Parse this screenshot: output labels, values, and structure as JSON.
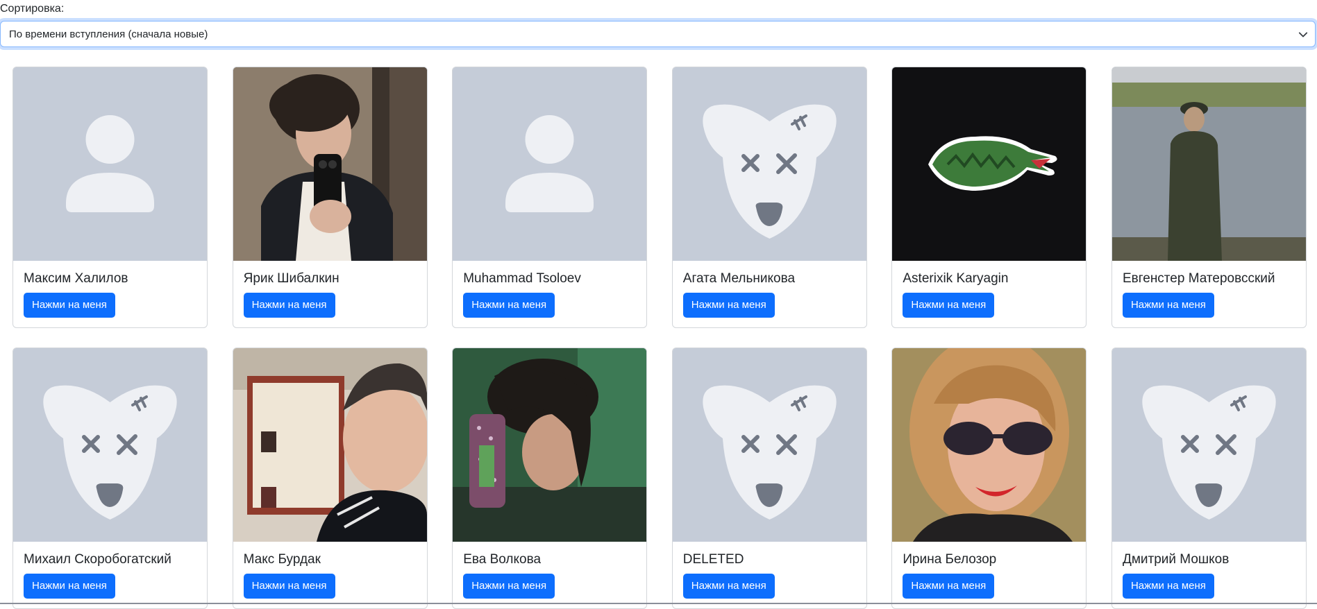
{
  "sort": {
    "label": "Сортировка:",
    "selected": "По времени вступления (сначала новые)"
  },
  "button_color": "#0d6efd",
  "members": [
    {
      "name": "Максим Халилов",
      "button": "Нажми на меня",
      "avatar": "default-person-avatar"
    },
    {
      "name": "Ярик Шибалкин",
      "button": "Нажми на меня",
      "avatar": "photo-mirror-selfie"
    },
    {
      "name": "Muhammad Tsoloev",
      "button": "Нажми на меня",
      "avatar": "default-person-avatar"
    },
    {
      "name": "Агата Мельникова",
      "button": "Нажми на меня",
      "avatar": "deleted-dog-avatar"
    },
    {
      "name": "Asterixik Karyagin",
      "button": "Нажми на меня",
      "avatar": "photo-crocodile-logo"
    },
    {
      "name": "Евгенстер Матеровсский",
      "button": "Нажми на меня",
      "avatar": "photo-man-by-lake"
    },
    {
      "name": "Михаил Скоробогатский",
      "button": "Нажми на меня",
      "avatar": "deleted-dog-avatar"
    },
    {
      "name": "Макс Бурдак",
      "button": "Нажми на меня",
      "avatar": "photo-boy-selfie"
    },
    {
      "name": "Ева Волкова",
      "button": "Нажми на меня",
      "avatar": "photo-girl-mirror"
    },
    {
      "name": "DELETED",
      "button": "Нажми на меня",
      "avatar": "deleted-dog-avatar"
    },
    {
      "name": "Ирина Белозор",
      "button": "Нажми на меня",
      "avatar": "photo-woman-sunglasses"
    },
    {
      "name": "Дмитрий Мошков",
      "button": "Нажми на меня",
      "avatar": "deleted-dog-avatar"
    }
  ]
}
